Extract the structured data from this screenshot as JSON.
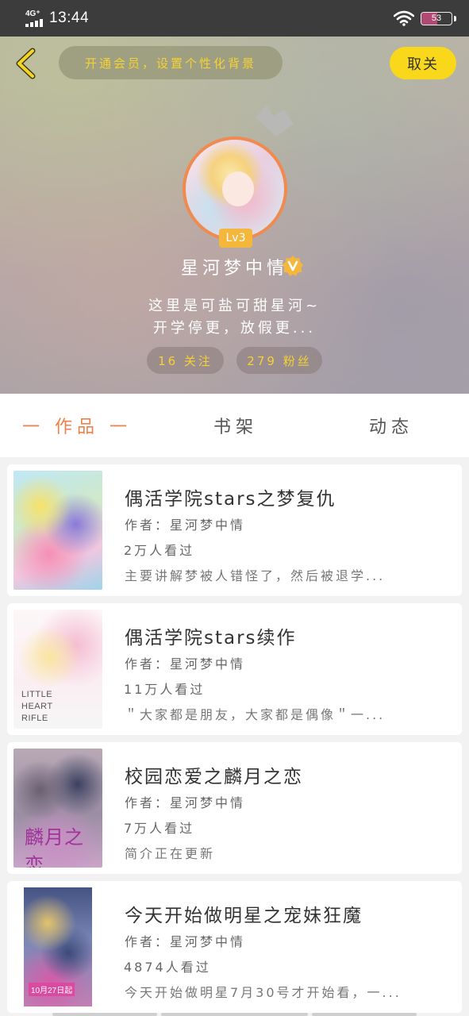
{
  "status_bar": {
    "network": "4G⁺",
    "time": "13:44",
    "battery": "53"
  },
  "header": {
    "vip_banner": "开通会员，设置个性化背景",
    "unfollow_label": "取关",
    "level": "Lv3",
    "username": "星河梦中情",
    "bio_line1": "这里是可盐可甜星河~",
    "bio_line2": "开学停更，放假更...",
    "following": "16 关注",
    "fans": "279 粉丝"
  },
  "tabs": {
    "works": "一 作品 一",
    "shelf": "书架",
    "feed": "动态"
  },
  "works": [
    {
      "title": "偶活学院stars之梦复仇",
      "author": "作者：星河梦中情",
      "views": "2万人看过",
      "desc": "主要讲解梦被人错怪了，然后被退学..."
    },
    {
      "title": "偶活学院stars续作",
      "author": "作者：星河梦中情",
      "views": "11万人看过",
      "desc": "＂大家都是朋友，大家都是偶像＂一...",
      "cover_text": [
        "LITTLE",
        "HEART",
        "RIFLE"
      ]
    },
    {
      "title": "校园恋爱之麟月之恋",
      "author": "作者：星河梦中情",
      "views": "7万人看过",
      "desc": "简介正在更新",
      "cover_text": "麟月之恋"
    },
    {
      "title": "今天开始做明星之宠妹狂魔",
      "author": "作者：星河梦中情",
      "views": "4874人看过",
      "desc": "今天开始做明星7月30号才开始看，一...",
      "cover_text": "10月27日起"
    }
  ],
  "colors": {
    "accent": "#f0804a",
    "yellow": "#f9d81b",
    "gold_text": "#f5d233"
  }
}
